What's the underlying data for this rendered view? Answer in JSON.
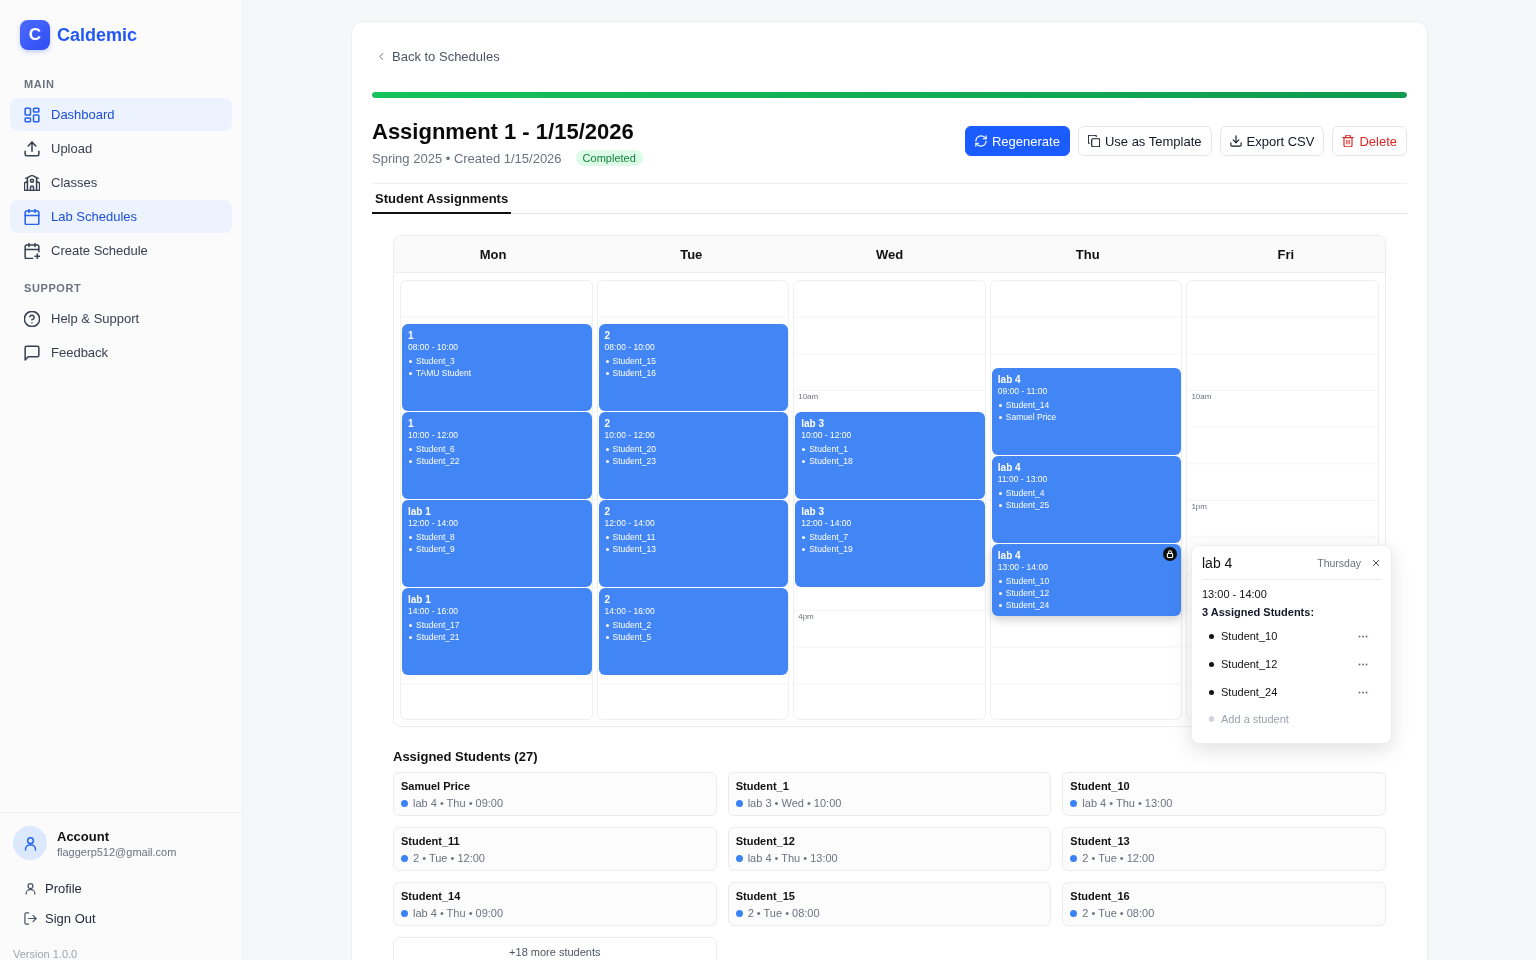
{
  "sidebar": {
    "brand": {
      "letter": "C",
      "name": "Caldemic"
    },
    "sections": [
      {
        "title": "MAIN",
        "items": [
          {
            "label": "Dashboard",
            "selected": true
          },
          {
            "label": "Upload",
            "selected": false
          },
          {
            "label": "Classes",
            "selected": false
          },
          {
            "label": "Lab Schedules",
            "selected": true
          },
          {
            "label": "Create Schedule",
            "selected": false
          }
        ]
      },
      {
        "title": "SUPPORT",
        "items": [
          {
            "label": "Help & Support",
            "selected": false
          },
          {
            "label": "Feedback",
            "selected": false
          }
        ]
      }
    ],
    "account": {
      "name": "Account",
      "email": "flaggerp512@gmail.com"
    },
    "account_links": [
      {
        "label": "Profile"
      },
      {
        "label": "Sign Out"
      }
    ],
    "version": "Version 1.0.0"
  },
  "page": {
    "back_link": "Back to Schedules",
    "progress": {
      "level": 1
    },
    "title": "Assignment 1 - 1/15/2026",
    "meta": "Spring 2025 • Created 1/15/2026",
    "status_badge": "Completed",
    "actions": [
      {
        "label": "Regenerate",
        "kind": "primary"
      },
      {
        "label": "Use as Template",
        "kind": "default"
      },
      {
        "label": "Export CSV",
        "kind": "default"
      },
      {
        "label": "Delete",
        "kind": "danger"
      }
    ],
    "tabs": [
      {
        "label": "Student Assignments",
        "selected": true
      }
    ],
    "calendar": {
      "days": [
        {
          "name": "Mon",
          "events": [
            {
              "title": "1",
              "time": "08:00 - 10:00",
              "students": [
                "Student_3",
                "TAMU Student"
              ],
              "hovered": false
            },
            {
              "title": "1",
              "time": "10:00 - 12:00",
              "students": [
                "Student_6",
                "Student_22"
              ],
              "hovered": false
            },
            {
              "title": "lab 1",
              "time": "12:00 - 14:00",
              "students": [
                "Student_8",
                "Student_9"
              ],
              "hovered": false
            },
            {
              "title": "lab 1",
              "time": "14:00 - 16:00",
              "students": [
                "Student_17",
                "Student_21"
              ],
              "hovered": false
            }
          ]
        },
        {
          "name": "Tue",
          "events": [
            {
              "title": "2",
              "time": "08:00 - 10:00",
              "students": [
                "Student_15",
                "Student_16"
              ],
              "hovered": false
            },
            {
              "title": "2",
              "time": "10:00 - 12:00",
              "students": [
                "Student_20",
                "Student_23"
              ],
              "hovered": false
            },
            {
              "title": "2",
              "time": "12:00 - 14:00",
              "students": [
                "Student_11",
                "Student_13"
              ],
              "hovered": false
            },
            {
              "title": "2",
              "time": "14:00 - 16:00",
              "students": [
                "Student_2",
                "Student_5"
              ],
              "hovered": false
            }
          ]
        },
        {
          "name": "Wed",
          "time_labels": [
            "10am",
            "4pm"
          ],
          "events": [
            {
              "title": "lab 3",
              "time": "10:00 - 12:00",
              "students": [
                "Student_1",
                "Student_18"
              ],
              "hovered": false
            },
            {
              "title": "lab 3",
              "time": "12:00 - 14:00",
              "students": [
                "Student_7",
                "Student_19"
              ],
              "hovered": false
            }
          ]
        },
        {
          "name": "Thu",
          "events": [
            {
              "title": "lab 4",
              "time": "09:00 - 11:00",
              "students": [
                "Student_14",
                "Samuel Price"
              ],
              "hovered": false
            },
            {
              "title": "lab 4",
              "time": "11:00 - 13:00",
              "students": [
                "Student_4",
                "Student_25"
              ],
              "hovered": false
            },
            {
              "title": "lab 4",
              "time": "13:00 - 14:00",
              "students": [
                "Student_10",
                "Student_12",
                "Student_24"
              ],
              "hovered": true
            }
          ]
        },
        {
          "name": "Fri",
          "time_labels": [
            "10am",
            "1pm"
          ]
        }
      ],
      "popover": {
        "title": "lab 4",
        "day": "Thursday",
        "time": "13:00 - 14:00",
        "count_label": "3 Assigned Students:",
        "students": [
          "Student_10",
          "Student_12",
          "Student_24"
        ],
        "add_placeholder": "Add a student"
      }
    },
    "assigned": {
      "title": "Assigned Students (27)",
      "students": [
        {
          "name": "Samuel Price",
          "detail": "lab 4 • Thu • 09:00"
        },
        {
          "name": "Student_1",
          "detail": "lab 3 • Wed • 10:00"
        },
        {
          "name": "Student_10",
          "detail": "lab 4 • Thu • 13:00"
        },
        {
          "name": "Student_11",
          "detail": "2 • Tue • 12:00"
        },
        {
          "name": "Student_12",
          "detail": "lab 4 • Thu • 13:00"
        },
        {
          "name": "Student_13",
          "detail": "2 • Tue • 12:00"
        },
        {
          "name": "Student_14",
          "detail": "lab 4 • Thu • 09:00"
        },
        {
          "name": "Student_15",
          "detail": "2 • Tue • 08:00"
        },
        {
          "name": "Student_16",
          "detail": "2 • Tue • 08:00"
        }
      ],
      "more_button": "+18 more students"
    }
  }
}
